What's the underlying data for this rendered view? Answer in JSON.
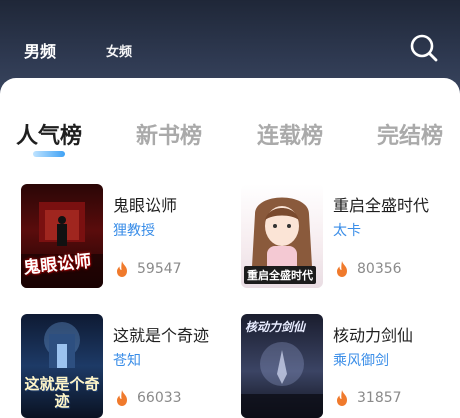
{
  "header": {
    "gender_tabs": [
      {
        "label": "男频",
        "active": true
      },
      {
        "label": "女频",
        "active": false
      }
    ],
    "search_icon": "search-icon"
  },
  "rank_tabs": [
    {
      "label": "人气榜",
      "active": true
    },
    {
      "label": "新书榜",
      "active": false
    },
    {
      "label": "连载榜",
      "active": false
    },
    {
      "label": "完结榜",
      "active": false
    }
  ],
  "books": [
    {
      "title": "鬼眼讼师",
      "author": "狸教授",
      "heat": "59547",
      "cover_text": "鬼眼讼师"
    },
    {
      "title": "重启全盛时代",
      "author": "太卡",
      "heat": "80356",
      "cover_text": "重启全盛时代"
    },
    {
      "title": "这就是个奇迹",
      "author": "苍知",
      "heat": "66033",
      "cover_text": "这就是个奇迹"
    },
    {
      "title": "核动力剑仙",
      "author": "乘风御剑",
      "heat": "31857",
      "cover_text": "核动力剑仙"
    }
  ],
  "colors": {
    "accent": "#3b8ee8",
    "fire": "#f07a2c",
    "header_bg": "#2b3446"
  }
}
